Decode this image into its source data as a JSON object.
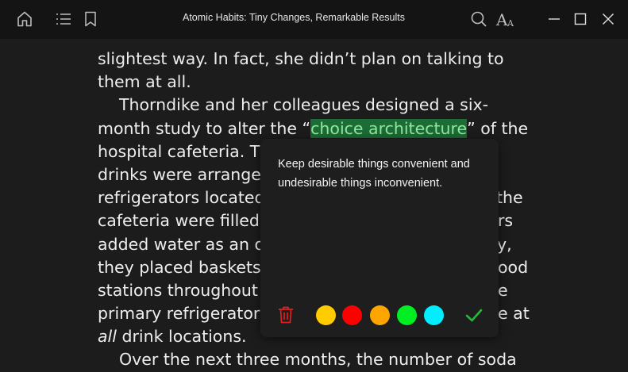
{
  "header": {
    "title": "Atomic Habits: Tiny Changes, Remarkable Results",
    "icons": [
      "home-icon",
      "toc-icon",
      "bookmark-icon",
      "search-icon",
      "font-settings-icon",
      "minimize-icon",
      "maximize-icon",
      "close-icon"
    ]
  },
  "page": {
    "lines": [
      "slightest way. In fact, she didn’t plan on talking to",
      "them at all.",
      "Thorndike and her colleagues designed a six-",
      "month study to alter the “",
      "choice architecture",
      "” of the",
      "hospital cafeteria. Th",
      "drinks were arrange",
      "refrigerators located",
      "the",
      "cafeteria were filled",
      "rs",
      "added water as an o",
      "y,",
      "they placed baskets",
      "ood",
      "stations throughout",
      "e",
      "primary refrigerator",
      "e at",
      "all",
      " drink locations.",
      "Over the next three months, the number of soda"
    ]
  },
  "popup": {
    "note": "Keep desirable things convenient and undesirable things inconvenient.",
    "colors": [
      "#ffcc00",
      "#ff0000",
      "#ffa500",
      "#00ee22",
      "#00eeff"
    ],
    "delete_color": "#e02020",
    "confirm_color": "#22bb33"
  }
}
